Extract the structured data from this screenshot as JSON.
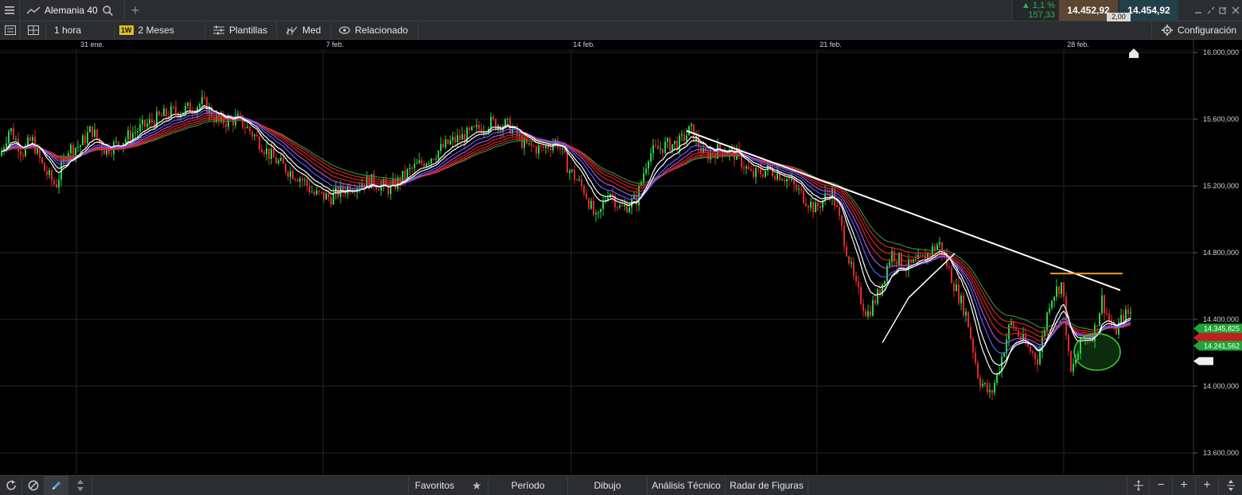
{
  "header": {
    "instrument": "Alemania 40",
    "change_pct": "▲ 1,1 %",
    "change_pts": "157,33",
    "sell_price": "14.452,92",
    "buy_price": "14.454,92",
    "spread": "2,00"
  },
  "toolbar": {
    "timeframe": "1 hora",
    "range_badge": "1W",
    "range": "2 Meses",
    "templates": "Plantillas",
    "indicator": "Med",
    "related": "Relacionado",
    "settings": "Configuración"
  },
  "chart_data": {
    "type": "candlestick",
    "x_axis_labels": [
      "31 ene.",
      "7 feb.",
      "14 feb.",
      "21 feb.",
      "28 feb."
    ],
    "y_axis_labels": [
      "16.000,000",
      "15.600,000",
      "15.200,000",
      "14.800,000",
      "14.400,000",
      "14.000,000",
      "13.600,000"
    ],
    "ylim": [
      13500,
      16050
    ],
    "price_tags": [
      "14.345,825",
      "14.241,562"
    ],
    "close_path": [
      [
        0,
        15380
      ],
      [
        12,
        15550
      ],
      [
        28,
        15400
      ],
      [
        40,
        15480
      ],
      [
        55,
        15300
      ],
      [
        70,
        15200
      ],
      [
        85,
        15420
      ],
      [
        100,
        15440
      ],
      [
        115,
        15540
      ],
      [
        130,
        15420
      ],
      [
        148,
        15450
      ],
      [
        165,
        15510
      ],
      [
        182,
        15560
      ],
      [
        200,
        15610
      ],
      [
        215,
        15640
      ],
      [
        235,
        15660
      ],
      [
        255,
        15700
      ],
      [
        275,
        15580
      ],
      [
        300,
        15600
      ],
      [
        320,
        15500
      ],
      [
        340,
        15380
      ],
      [
        360,
        15300
      ],
      [
        378,
        15250
      ],
      [
        395,
        15150
      ],
      [
        415,
        15130
      ],
      [
        440,
        15200
      ],
      [
        465,
        15230
      ],
      [
        490,
        15180
      ],
      [
        515,
        15290
      ],
      [
        540,
        15370
      ],
      [
        565,
        15460
      ],
      [
        590,
        15510
      ],
      [
        615,
        15580
      ],
      [
        640,
        15560
      ],
      [
        660,
        15440
      ],
      [
        680,
        15420
      ],
      [
        700,
        15470
      ],
      [
        715,
        15300
      ],
      [
        735,
        15170
      ],
      [
        750,
        14980
      ],
      [
        765,
        15180
      ],
      [
        780,
        15060
      ],
      [
        800,
        15120
      ],
      [
        815,
        15390
      ],
      [
        835,
        15440
      ],
      [
        855,
        15460
      ],
      [
        868,
        15540
      ],
      [
        885,
        15380
      ],
      [
        905,
        15420
      ],
      [
        925,
        15390
      ],
      [
        945,
        15260
      ],
      [
        965,
        15300
      ],
      [
        985,
        15260
      ],
      [
        1005,
        15160
      ],
      [
        1025,
        15060
      ],
      [
        1045,
        15180
      ],
      [
        1060,
        14900
      ],
      [
        1075,
        14600
      ],
      [
        1090,
        14430
      ],
      [
        1105,
        14560
      ],
      [
        1120,
        14800
      ],
      [
        1140,
        14710
      ],
      [
        1160,
        14760
      ],
      [
        1180,
        14860
      ],
      [
        1200,
        14600
      ],
      [
        1215,
        14420
      ],
      [
        1230,
        14050
      ],
      [
        1245,
        13940
      ],
      [
        1255,
        14100
      ],
      [
        1270,
        14380
      ],
      [
        1290,
        14240
      ],
      [
        1305,
        14160
      ],
      [
        1320,
        14530
      ],
      [
        1335,
        14620
      ],
      [
        1345,
        14060
      ],
      [
        1360,
        14270
      ],
      [
        1375,
        14320
      ],
      [
        1385,
        14520
      ],
      [
        1400,
        14310
      ],
      [
        1412,
        14420
      ],
      [
        1422,
        14440
      ]
    ],
    "colors": {
      "up": "#2bd24a",
      "down": "#e02a2a",
      "ma_fast": "#ffffff",
      "ma_blue": "#5560ff",
      "ma_purple": "#b050e0",
      "ma_red": "#d02828",
      "ma_green": "#2e8b3a",
      "trendline": "#ffffff",
      "resistance": "#f0a030",
      "highlight": "#38c83a"
    }
  },
  "footer": {
    "favorites": "Favoritos",
    "period": "Período",
    "drawing": "Dibujo",
    "technical": "Análisis Técnico",
    "patterns": "Radar de Figuras"
  }
}
